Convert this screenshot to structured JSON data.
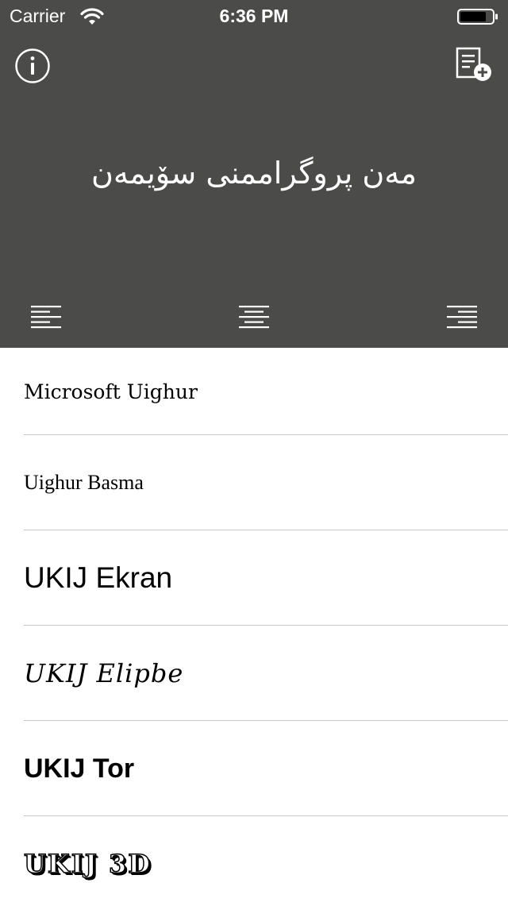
{
  "status_bar": {
    "carrier": "Carrier",
    "time": "6:36 PM"
  },
  "header": {
    "preview_text": "مەن پروگراممنى سۆيمەن",
    "background_color": "#4b4c4a"
  },
  "icons": {
    "info": "info-icon",
    "add_document": "add-document-icon",
    "align_left": "align-left-icon",
    "align_center": "align-center-icon",
    "align_right": "align-right-icon"
  },
  "fonts": [
    {
      "label": "Microsoft Uighur"
    },
    {
      "label": "Uighur Basma"
    },
    {
      "label": "UKIJ Ekran"
    },
    {
      "label": "UKIJ Elipbe"
    },
    {
      "label": "UKIJ Tor"
    },
    {
      "label": "UKIJ 3D"
    }
  ]
}
